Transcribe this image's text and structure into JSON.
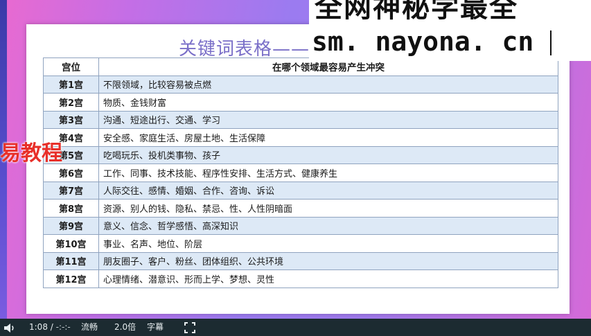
{
  "slide": {
    "title": "关键词表格——",
    "table": {
      "headers": [
        "宫位",
        "在哪个领域最容易产生冲突"
      ],
      "rows": [
        {
          "pos": "第1宫",
          "desc": "不限领域，比较容易被点燃"
        },
        {
          "pos": "第2宫",
          "desc": "物质、金钱财富"
        },
        {
          "pos": "第3宫",
          "desc": "沟通、短途出行、交通、学习"
        },
        {
          "pos": "第4宫",
          "desc": "安全感、家庭生活、房屋土地、生活保障"
        },
        {
          "pos": "第5宫",
          "desc": "吃喝玩乐、投机类事物、孩子"
        },
        {
          "pos": "第6宫",
          "desc": "工作、同事、技术技能、程序性安排、生活方式、健康养生"
        },
        {
          "pos": "第7宫",
          "desc": "人际交往、感情、婚姻、合作、咨询、诉讼"
        },
        {
          "pos": "第8宫",
          "desc": "资源、别人的钱、隐私、禁忌、性、人性阴暗面"
        },
        {
          "pos": "第9宫",
          "desc": "意义、信念、哲学感悟、高深知识"
        },
        {
          "pos": "第10宫",
          "desc": "事业、名声、地位、阶层"
        },
        {
          "pos": "第11宫",
          "desc": "朋友圈子、客户、粉丝、团体组织、公共环境"
        },
        {
          "pos": "第12宫",
          "desc": "心理情绪、潜意识、形而上学、梦想、灵性"
        }
      ]
    }
  },
  "overlay": {
    "left_text": "易教程",
    "watermark_top": "全网神秘学最全",
    "watermark_url": "sm. nayona. cn"
  },
  "player": {
    "volume_icon": "speaker-icon",
    "time_current": "1:08",
    "time_sep": " / ",
    "time_total": "-:-:-",
    "quality": "流畅",
    "speed": "2.0倍",
    "subtitles": "字幕",
    "fullscreen_icon": "fullscreen-icon"
  },
  "colors": {
    "title": "#7a6fc8",
    "row_alt": "#dde9f6",
    "border": "#8fa3bf",
    "player_bg": "#1c2b31",
    "overlay_red": "#e8302a"
  }
}
